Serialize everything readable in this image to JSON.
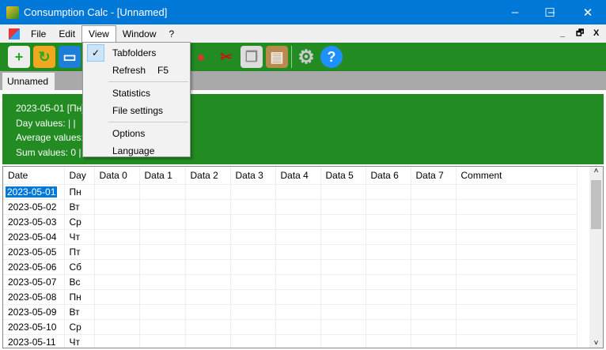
{
  "window": {
    "title": "Consumption Calc - [Unnamed]",
    "minimize": "–",
    "maximize": "☐",
    "close": "✕"
  },
  "menubar": {
    "items": [
      "File",
      "Edit",
      "View",
      "Window",
      "?"
    ],
    "mdi_min": "_",
    "mdi_restore": "🗗",
    "mdi_close": "X"
  },
  "toolbar": {
    "icons": [
      "new-file-icon",
      "open-folder-icon",
      "save-icon",
      "delete-icon",
      "cut-icon",
      "copy-icon",
      "paste-icon",
      "settings-icon",
      "help-icon"
    ]
  },
  "tabs": [
    {
      "label": "Unnamed"
    }
  ],
  "info": {
    "line1": "2023-05-01 [Пн]",
    "line2": "Day values:  | |",
    "line3": "Average values:",
    "line4": "Sum values: 0 | 0"
  },
  "view_menu": {
    "items": [
      {
        "label": "Tabfolders",
        "checked": true
      },
      {
        "label": "Refresh",
        "shortcut": "F5"
      },
      {
        "label": "Statistics"
      },
      {
        "label": "File settings"
      },
      {
        "label": "Options"
      },
      {
        "label": "Language"
      }
    ]
  },
  "grid": {
    "columns": [
      "Date",
      "Day",
      "Data 0",
      "Data 1",
      "Data 2",
      "Data 3",
      "Data 4",
      "Data 5",
      "Data 6",
      "Data 7",
      "Comment"
    ],
    "rows": [
      [
        "2023-05-01",
        "Пн"
      ],
      [
        "2023-05-02",
        "Вт"
      ],
      [
        "2023-05-03",
        "Ср"
      ],
      [
        "2023-05-04",
        "Чт"
      ],
      [
        "2023-05-05",
        "Пт"
      ],
      [
        "2023-05-06",
        "Сб"
      ],
      [
        "2023-05-07",
        "Вс"
      ],
      [
        "2023-05-08",
        "Пн"
      ],
      [
        "2023-05-09",
        "Вт"
      ],
      [
        "2023-05-10",
        "Ср"
      ],
      [
        "2023-05-11",
        "Чт"
      ]
    ],
    "scroll_up": "˄",
    "scroll_down": "˅"
  },
  "colors": {
    "titlebar": "#0078d7",
    "toolbar": "#228b22",
    "selection": "#0078d7"
  }
}
